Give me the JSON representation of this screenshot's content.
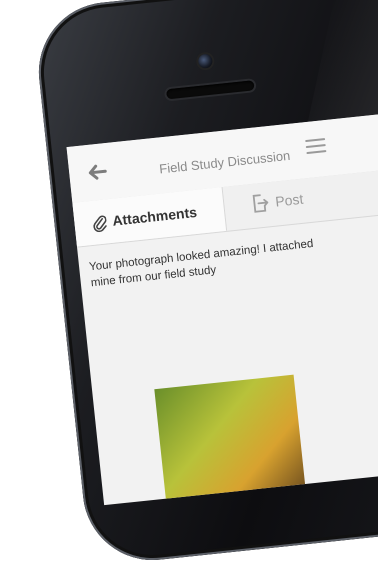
{
  "header": {
    "title": "Field Study Discussion"
  },
  "tabs": [
    {
      "label": "Attachments",
      "active": true
    },
    {
      "label": "Post",
      "active": false
    }
  ],
  "message": {
    "text": "Your photograph looked amazing! I attached mine from our field study"
  },
  "icons": {
    "back": "back-arrow-icon",
    "menu": "hamburger-menu-icon",
    "attachments": "paperclip-icon",
    "post": "export-icon"
  },
  "colors": {
    "phone_body": "#141416",
    "screen_bg": "#f2f2f2",
    "header_bg": "#f7f7f7",
    "active_tab": "#fbfbfb"
  }
}
